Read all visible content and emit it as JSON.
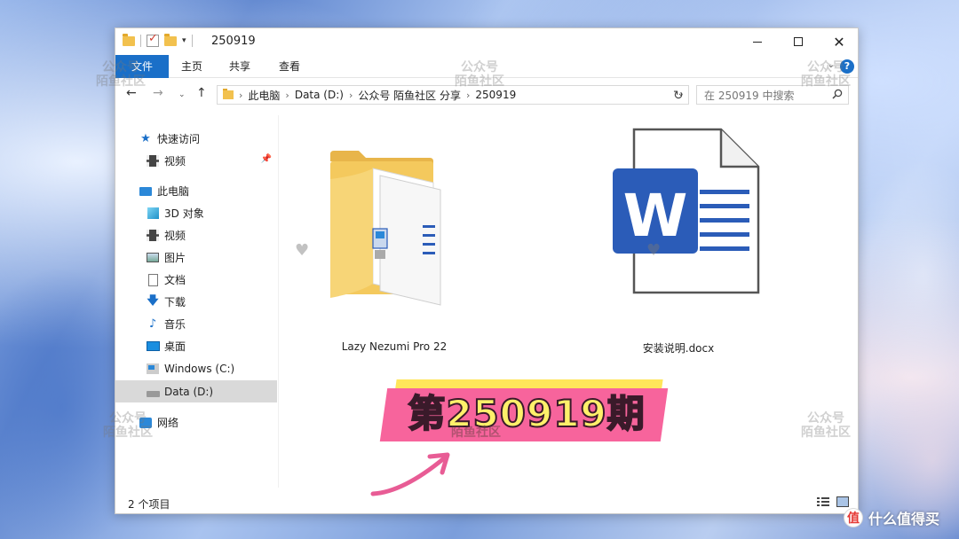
{
  "window": {
    "title": "250919",
    "controls": {
      "minimize": "minimize",
      "maximize": "maximize",
      "close": "✕"
    }
  },
  "ribbon": {
    "tabs": [
      "文件",
      "主页",
      "共享",
      "查看"
    ],
    "help": "?"
  },
  "address": {
    "segments": [
      "此电脑",
      "Data (D:)",
      "公众号 陌鱼社区 分享",
      "250919"
    ],
    "search_placeholder": "在 250919 中搜索"
  },
  "nav": {
    "items": [
      {
        "label": "快速访问",
        "icon": "star-icon"
      },
      {
        "label": "视频",
        "icon": "video-icon"
      },
      {
        "label": "此电脑",
        "icon": "computer-icon"
      },
      {
        "label": "3D 对象",
        "icon": "cube-icon"
      },
      {
        "label": "视频",
        "icon": "video-icon"
      },
      {
        "label": "图片",
        "icon": "picture-icon"
      },
      {
        "label": "文档",
        "icon": "document-icon"
      },
      {
        "label": "下载",
        "icon": "download-icon"
      },
      {
        "label": "音乐",
        "icon": "music-icon"
      },
      {
        "label": "桌面",
        "icon": "desktop-icon"
      },
      {
        "label": "Windows (C:)",
        "icon": "windows-drive-icon"
      },
      {
        "label": "Data (D:)",
        "icon": "drive-icon",
        "selected": true
      },
      {
        "label": "网络",
        "icon": "network-icon"
      }
    ]
  },
  "files": [
    {
      "name": "Lazy Nezumi Pro 22",
      "type": "folder"
    },
    {
      "name": "安装说明.docx",
      "type": "word-document"
    }
  ],
  "status": {
    "count": "2 个项目"
  },
  "overlay": {
    "banner": "第250919期",
    "watermark_line1": "公众号",
    "watermark_line2": "陌鱼社区",
    "brand_logo": "值",
    "brand_text": "什么值得买"
  },
  "colors": {
    "accent": "#1a6fc8",
    "banner_pink": "#f7649c",
    "banner_yellow": "#ffe65a",
    "word_blue": "#2b5cb8"
  }
}
